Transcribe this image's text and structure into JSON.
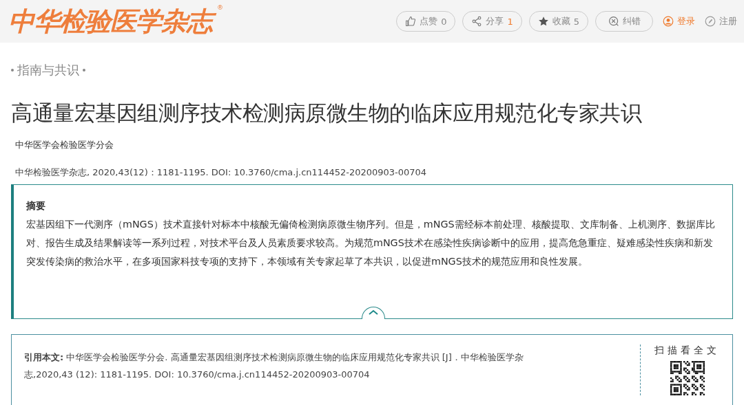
{
  "header": {
    "logo": "中华检验医学杂志",
    "registered_mark": "®",
    "actions": [
      {
        "kind": "like",
        "label": "点赞",
        "count": "0",
        "active": false
      },
      {
        "kind": "share",
        "label": "分享",
        "count": "1",
        "active": true
      },
      {
        "kind": "favorite",
        "label": "收藏",
        "count": "5",
        "active": false
      },
      {
        "kind": "correct",
        "label": "纠错"
      }
    ],
    "login": "登录",
    "register": "注册"
  },
  "column": "指南与共识",
  "title": "高通量宏基因组测序技术检测病原微生物的临床应用规范化专家共识",
  "author": "中华医学会检验医学分会",
  "source": "中华检验医学杂志, 2020,43(12)：1181-1195. DOI: 10.3760/cma.j.cn114452-20200903-00704",
  "abstract": {
    "heading": "摘要",
    "text": "宏基因组下一代测序（mNGS）技术直接针对标本中核酸无偏倚检测病原微生物序列。但是，mNGS需经标本前处理、核酸提取、文库制备、上机测序、数据库比对、报告生成及结果解读等一系列过程，对技术平台及人员素质要求较高。为规范mNGS技术在感染性疾病诊断中的应用，提高危急重症、疑难感染性疾病和新发突发传染病的救治水平，在多项国家科技专项的支持下，本领域有关专家起草了本共识，以促进mNGS技术的规范应用和良性发展。",
    "expanded": true
  },
  "citation": {
    "text": "**引用本文:** 中华医学会检验医学分会. 高通量宏基因组测序技术检测病原微生物的临床应用规范化专家共识 [J]．中华检验医学杂志,2020,43 (12): 1181-1195. DOI: 10.3760/cma.j.cn114452-20200903-00704",
    "qr_label": "扫描看全文"
  }
}
